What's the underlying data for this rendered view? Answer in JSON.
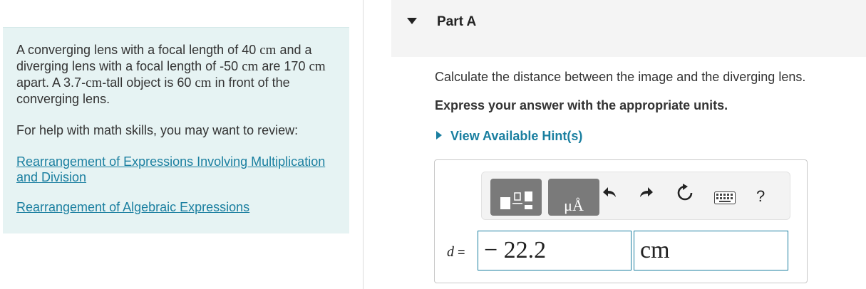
{
  "problem": {
    "text_1": "A converging lens with a focal length of 40 ",
    "unit_a": "cm",
    "text_2": " and a diverging lens with a focal length of -50 ",
    "unit_b": "cm",
    "text_3": " are 170 ",
    "unit_c": "cm",
    "text_4": " apart. A 3.7-",
    "unit_d": "cm",
    "text_5": "-tall object is 60 ",
    "unit_e": "cm",
    "text_6": " in front of the converging lens.",
    "help_text": "For help with math skills, you may want to review:",
    "links": [
      "Rearrangement of Expressions Involving Multiplication and Division",
      "Rearrangement of Algebraic Expressions"
    ]
  },
  "part": {
    "title": "Part A",
    "question": "Calculate the distance between the image and the diverging lens.",
    "instruction": "Express your answer with the appropriate units.",
    "hint_label": "View Available Hint(s)"
  },
  "toolbar": {
    "units_symbol": "μÅ",
    "help_symbol": "?",
    "icons": [
      "templates-icon",
      "units-icon",
      "undo-icon",
      "redo-icon",
      "reset-icon",
      "keyboard-icon",
      "help-icon"
    ]
  },
  "answer": {
    "variable": "d",
    "equals": " =",
    "value": "− 22.2",
    "unit": "cm"
  },
  "colors": {
    "panel_bg": "#e6f3f3",
    "link": "#1a7fa0",
    "header_bg": "#f4f4f4",
    "tool_button": "#7a7a7a"
  }
}
